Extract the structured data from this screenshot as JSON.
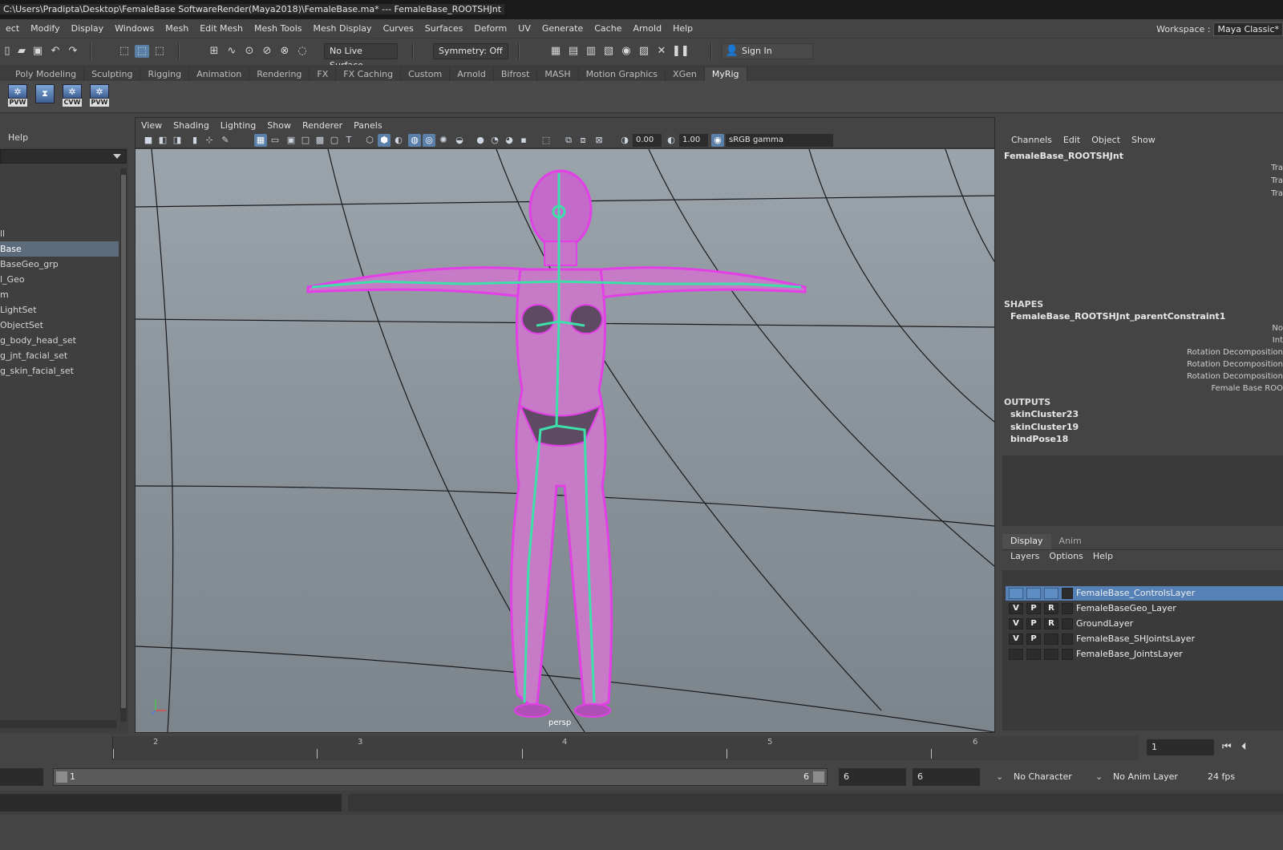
{
  "window": {
    "title": "C:\\Users\\Pradipta\\Desktop\\FemaleBase SoftwareRender(Maya2018)\\FemaleBase.ma*  ---  FemaleBase_ROOTSHJnt"
  },
  "menubar": [
    "ect",
    "Modify",
    "Display",
    "Windows",
    "Mesh",
    "Edit Mesh",
    "Mesh Tools",
    "Mesh Display",
    "Curves",
    "Surfaces",
    "Deform",
    "UV",
    "Generate",
    "Cache",
    "Arnold",
    "Help"
  ],
  "workspace": {
    "label": "Workspace :",
    "value": "Maya Classic*"
  },
  "statusline": {
    "live_surface": "No Live Surface",
    "symmetry": "Symmetry: Off",
    "sign_in": "Sign In"
  },
  "shelf": {
    "tabs": [
      "Poly Modeling",
      "Sculpting",
      "Rigging",
      "Animation",
      "Rendering",
      "FX",
      "FX Caching",
      "Custom",
      "Arnold",
      "Bifrost",
      "MASH",
      "Motion Graphics",
      "XGen",
      "MyRig"
    ],
    "active_tab": "MyRig",
    "buttons": [
      "PVW",
      "",
      "CVW",
      "PVW"
    ]
  },
  "outliner": {
    "header": "Help",
    "items": [
      "ll",
      "Base",
      "BaseGeo_grp",
      "l_Geo",
      "m",
      "LightSet",
      "ObjectSet",
      "g_body_head_set",
      "g_jnt_facial_set",
      "g_skin_facial_set"
    ],
    "selected_index": 1
  },
  "viewport": {
    "menu": [
      "View",
      "Shading",
      "Lighting",
      "Show",
      "Renderer",
      "Panels"
    ],
    "exposure": "0.00",
    "gamma": "1.00",
    "color_space": "sRGB gamma",
    "camera_label": "persp",
    "accent_mesh": "#e23fe6",
    "accent_joints": "#3ce0a8"
  },
  "channel_box": {
    "menu": [
      "Channels",
      "Edit",
      "Object",
      "Show"
    ],
    "object": "FemaleBase_ROOTSHJnt",
    "attr_truncated": [
      "Tra",
      "Tra",
      "Tra"
    ],
    "shapes_header": "SHAPES",
    "shape_node": "FemaleBase_ROOTSHJnt_parentConstraint1",
    "shape_attrs": [
      "No",
      "Int",
      "Rotation Decomposition",
      "Rotation Decomposition",
      "Rotation Decomposition",
      "Female Base ROO"
    ],
    "outputs_header": "OUTPUTS",
    "outputs": [
      "skinCluster23",
      "skinCluster19",
      "bindPose18"
    ]
  },
  "layers": {
    "tabs": [
      "Display",
      "Anim"
    ],
    "active_tab": "Display",
    "menu": [
      "Layers",
      "Options",
      "Help"
    ],
    "rows": [
      {
        "v": "",
        "p": "",
        "r": "",
        "name": "FemaleBase_ControlsLayer",
        "selected": true
      },
      {
        "v": "V",
        "p": "P",
        "r": "R",
        "name": "FemaleBaseGeo_Layer",
        "selected": false
      },
      {
        "v": "V",
        "p": "P",
        "r": "R",
        "name": "GroundLayer",
        "selected": false
      },
      {
        "v": "V",
        "p": "P",
        "r": "",
        "name": "FemaleBase_SHJointsLayer",
        "selected": false
      },
      {
        "v": "",
        "p": "",
        "r": "",
        "name": "FemaleBase_JointsLayer",
        "selected": false
      }
    ]
  },
  "timeslider": {
    "ticks": [
      "2",
      "3",
      "4",
      "5",
      "6"
    ],
    "current_frame": "1"
  },
  "range_slider": {
    "start": "1",
    "range_end": "6",
    "end_field": "6",
    "end_field2": "6",
    "character_set": "No Character Set",
    "anim_layer": "No Anim Layer",
    "fps": "24 fps"
  }
}
